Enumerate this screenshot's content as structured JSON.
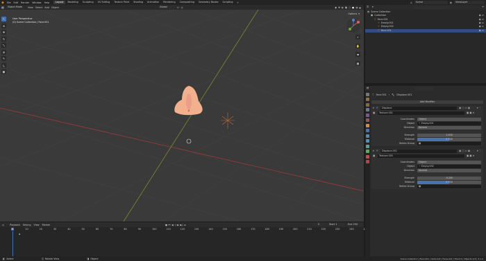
{
  "menu": {
    "file": "File",
    "edit": "Edit",
    "render": "Render",
    "window": "Window",
    "help": "Help"
  },
  "workspaces": [
    "Layout",
    "Modeling",
    "Sculpting",
    "UV Editing",
    "Texture Paint",
    "Shading",
    "Animation",
    "Rendering",
    "Compositing",
    "Geometry Nodes",
    "Scripting"
  ],
  "scene": "Scene",
  "view_layer": "ViewLayer",
  "viewport": {
    "mode": "Object Mode",
    "menus": [
      "View",
      "Select",
      "Add",
      "Object"
    ],
    "transform": "Global",
    "info_line1": "User Perspective",
    "info_line2": "(0) Scene Collection | Face.001",
    "options": "Options"
  },
  "timeline": {
    "menus": [
      "Playback",
      "Keying",
      "View",
      "Marker"
    ],
    "current_frame": "0",
    "start_label": "Start",
    "start": "1",
    "end_label": "End",
    "end": "250",
    "frames": [
      "0",
      "10",
      "20",
      "30",
      "40",
      "50",
      "60",
      "70",
      "80",
      "90",
      "100",
      "110",
      "120",
      "130",
      "140",
      "150",
      "160",
      "170",
      "180",
      "190",
      "200",
      "210",
      "220",
      "230",
      "240",
      "250"
    ]
  },
  "status": {
    "select": "Select",
    "rotate": "Rotate View",
    "object": "Object",
    "right": "Scene Collection | Face.001 | Verts:2/2 | Faces:0/1 | Tris:0/1 | Objects:1/3 | 3.1.2"
  },
  "outliner": {
    "items": [
      {
        "label": "Scene Collection",
        "indent": 0
      },
      {
        "label": "Collection",
        "indent": 1
      },
      {
        "label": "Face.001",
        "indent": 2
      },
      {
        "label": "Empty.001",
        "indent": 3
      },
      {
        "label": "Empty.002",
        "indent": 3
      },
      {
        "label": "Face.001",
        "indent": 3,
        "selected": true
      }
    ]
  },
  "properties": {
    "search_placeholder": "",
    "path_object": "Face.001",
    "path_modifier": "Displace.001",
    "add_modifier": "Add Modifier",
    "modifiers": [
      {
        "name": "Displace",
        "texture": "Texture.001",
        "coordinates_label": "Coordinates",
        "coordinates": "Object",
        "object_label": "Object",
        "object": "Empty.001",
        "direction_label": "Direction",
        "direction": "Normal",
        "strength_label": "Strength",
        "strength": "1.000",
        "midlevel_label": "Midlevel",
        "midlevel": "0.500",
        "midlevel_fill": 0.5,
        "vgroup_label": "Vertex Group"
      },
      {
        "name": "Displace.001",
        "texture": "Texture.005",
        "coordinates_label": "Coordinates",
        "coordinates": "Object",
        "object_label": "Object",
        "object": "Empty.002",
        "direction_label": "Direction",
        "direction": "Normal",
        "strength_label": "Strength",
        "strength": "-0.200",
        "midlevel_label": "Midlevel",
        "midlevel": "0.500",
        "midlevel_fill": 0.5,
        "vgroup_label": "Vertex Group"
      }
    ]
  },
  "colors": {
    "accent": "#4772b3",
    "x_axis": "#9e3b3b",
    "y_axis": "#7e8a2e",
    "object": "#f3b08c"
  }
}
